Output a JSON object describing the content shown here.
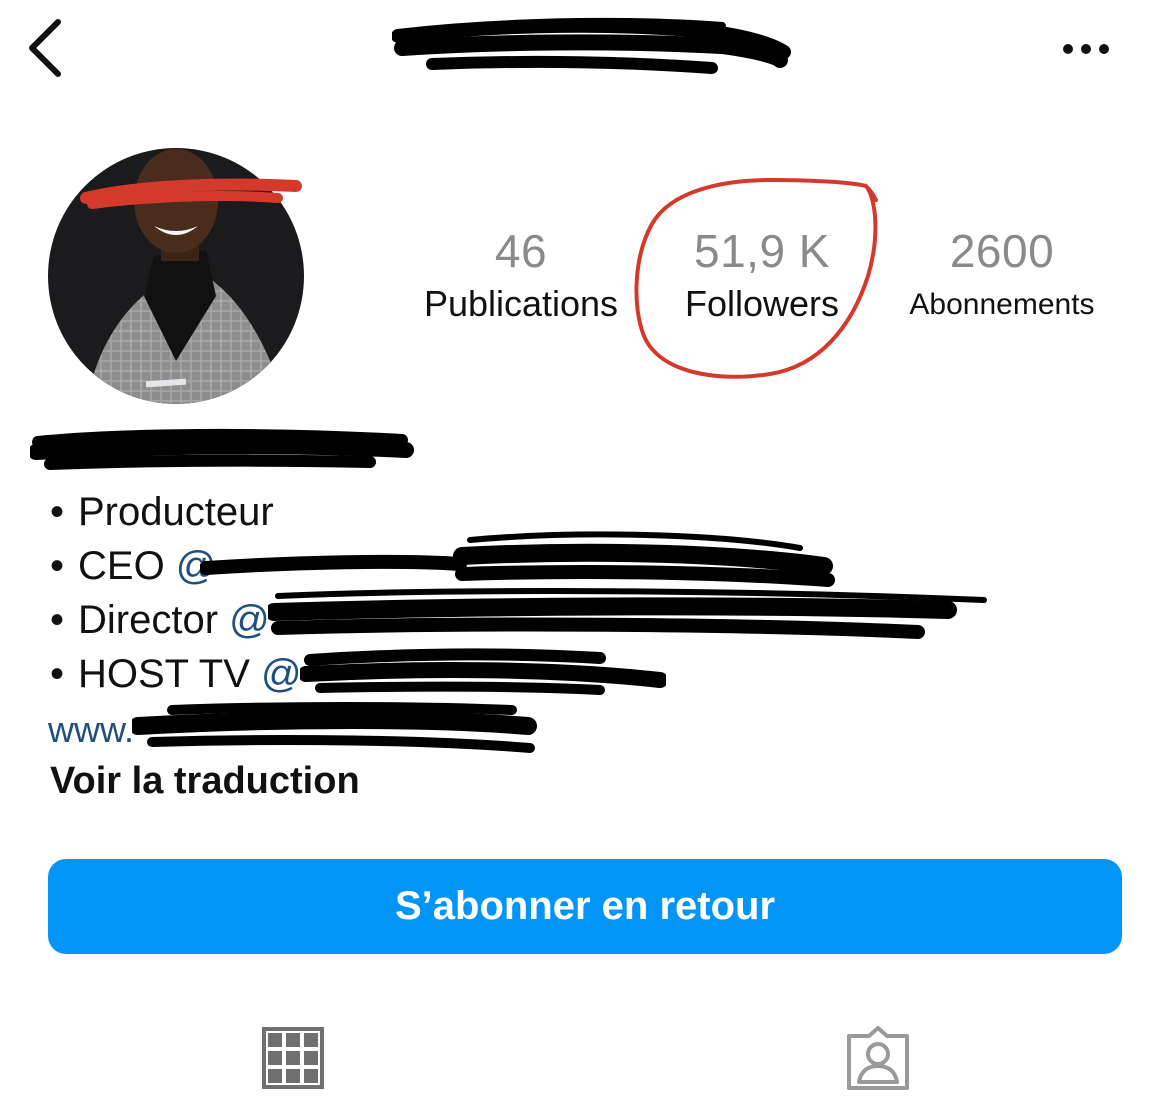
{
  "header": {
    "back_icon": "chevron-left-icon",
    "more_icon": "more-horizontal-icon"
  },
  "stats": {
    "publications": {
      "value": "46",
      "label": "Publications"
    },
    "followers": {
      "value": "51,9 K",
      "label": "Followers"
    },
    "abonnements": {
      "value": "2600",
      "label": "Abonnements"
    }
  },
  "bio": {
    "bullet": "•",
    "line1": "Producteur",
    "line2_prefix": "CEO ",
    "line2_mention": "@",
    "line3_prefix": "Director ",
    "line3_mention": "@",
    "line4_prefix": "HOST TV ",
    "line4_mention": "@",
    "website": "www.",
    "translate": "Voir la traduction"
  },
  "actions": {
    "follow_back_label": "S’abonner en retour"
  },
  "tabs": {
    "grid_icon": "grid-icon",
    "tagged_icon": "tagged-person-icon"
  },
  "colors": {
    "accent": "#0095f6",
    "link": "#1f4f7a",
    "annotation": "#d33a2c",
    "redaction": "#000000"
  }
}
